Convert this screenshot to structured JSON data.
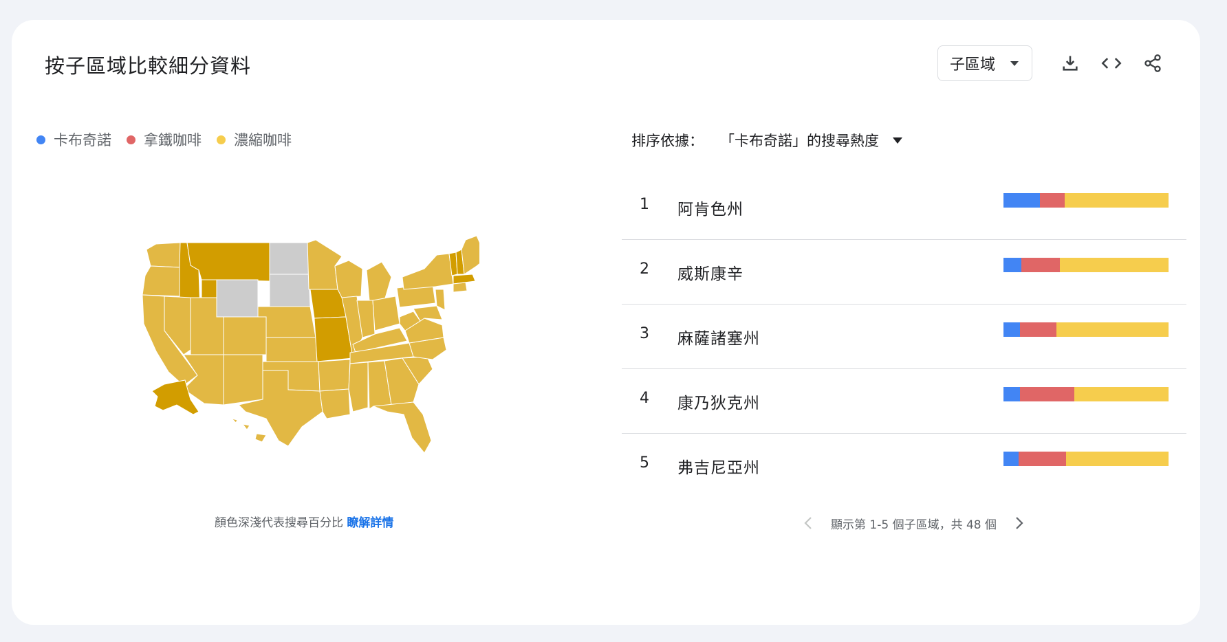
{
  "title": "按子區域比較細分資料",
  "toolbar": {
    "region_select": "子區域",
    "icons": [
      "download-icon",
      "embed-code-icon",
      "share-icon"
    ]
  },
  "legend": [
    {
      "label": "卡布奇諾",
      "color": "#4285f4"
    },
    {
      "label": "拿鐵咖啡",
      "color": "#e06666"
    },
    {
      "label": "濃縮咖啡",
      "color": "#f6cd4d"
    }
  ],
  "colors": {
    "cappuccino": "#4285f4",
    "latte": "#e06666",
    "espresso": "#f6cd4d",
    "map_light": "#e2b844",
    "map_dark": "#d29d00",
    "map_nodata": "#cccccc"
  },
  "map_note": {
    "text": "顏色深淺代表搜尋百分比 ",
    "link": "瞭解詳情"
  },
  "sort": {
    "label": "排序依據：",
    "value": "「卡布奇諾」的搜尋熱度"
  },
  "rankings": [
    {
      "rank": "1",
      "name": "阿肯色州",
      "shares": [
        22,
        15,
        63
      ]
    },
    {
      "rank": "2",
      "name": "威斯康辛",
      "shares": [
        11,
        23,
        66
      ]
    },
    {
      "rank": "3",
      "name": "麻薩諸塞州",
      "shares": [
        10,
        22,
        68
      ]
    },
    {
      "rank": "4",
      "name": "康乃狄克州",
      "shares": [
        10,
        33,
        57
      ]
    },
    {
      "rank": "5",
      "name": "弗吉尼亞州",
      "shares": [
        9,
        29,
        62
      ]
    }
  ],
  "pagination": {
    "text": "顯示第 1-5 個子區域，共 48 個"
  }
}
